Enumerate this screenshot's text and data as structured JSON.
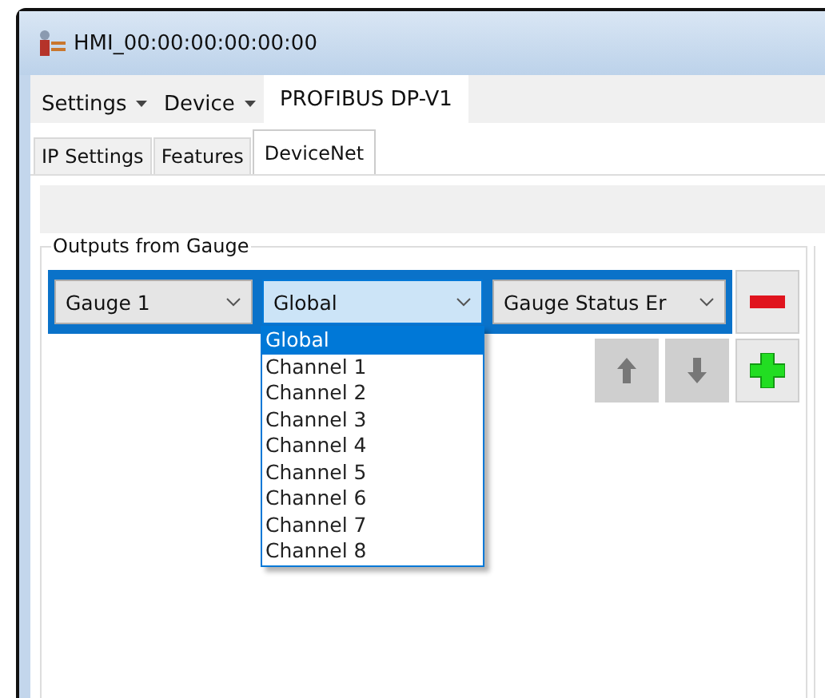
{
  "window": {
    "title": "HMI_00:00:00:00:00:00"
  },
  "menu": [
    {
      "label": "Settings",
      "kind": "dropdown"
    },
    {
      "label": "Device",
      "kind": "dropdown"
    },
    {
      "label": "PROFIBUS DP-V1",
      "kind": "tab"
    }
  ],
  "tabs": [
    {
      "label": "IP Settings",
      "selected": false
    },
    {
      "label": "Features",
      "selected": false
    },
    {
      "label": "DeviceNet",
      "selected": true
    }
  ],
  "group": {
    "title": "Outputs from Gauge",
    "row": {
      "selected": true,
      "combos": [
        {
          "value": "Gauge 1",
          "open": false
        },
        {
          "value": "Global",
          "open": true
        },
        {
          "value": "Gauge Status Er",
          "open": false
        }
      ]
    },
    "dropdown_items": [
      {
        "label": "Global",
        "selected": true
      },
      {
        "label": "Channel 1",
        "selected": false
      },
      {
        "label": "Channel 2",
        "selected": false
      },
      {
        "label": "Channel 3",
        "selected": false
      },
      {
        "label": "Channel 4",
        "selected": false
      },
      {
        "label": "Channel 5",
        "selected": false
      },
      {
        "label": "Channel 6",
        "selected": false
      },
      {
        "label": "Channel 7",
        "selected": false
      },
      {
        "label": "Channel 8",
        "selected": false
      }
    ],
    "buttons": [
      {
        "kind": "move-up",
        "disabled": true
      },
      {
        "kind": "move-down",
        "disabled": true
      },
      {
        "kind": "add",
        "disabled": false
      }
    ]
  }
}
